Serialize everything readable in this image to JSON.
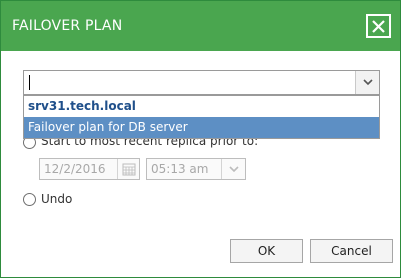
{
  "dialog": {
    "title": "FAILOVER PLAN",
    "close_icon": "close-icon"
  },
  "combo": {
    "value": "",
    "dropdown_icon": "chevron-down-icon",
    "options": [
      "srv31.tech.local",
      "Failover plan for DB server"
    ],
    "selected_option": "Failover plan for DB server"
  },
  "options": {
    "replica_label": "Start to most recent replica prior to:",
    "date_value": "12/2/2016",
    "calendar_icon": "calendar-icon",
    "time_value": "05:13 am",
    "time_dropdown_icon": "chevron-down-icon",
    "undo_label": "Undo"
  },
  "buttons": {
    "ok": "OK",
    "cancel": "Cancel"
  },
  "colors": {
    "titlebar": "#4aa64f",
    "selection": "#5d8fc4",
    "server_text": "#1f4f8a"
  }
}
